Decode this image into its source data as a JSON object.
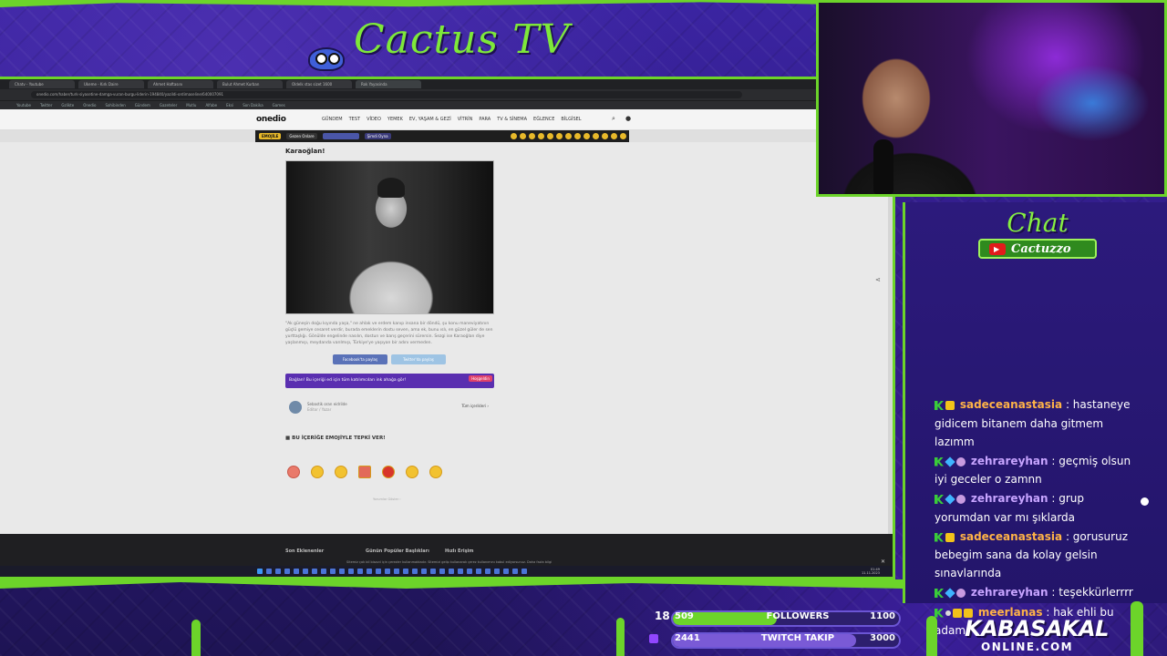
{
  "overlay": {
    "brand_title": "Cactus TV",
    "chat_title": "Chat",
    "chat_channel": "Cactuzzo",
    "sponsor_name": "KABASAKAL",
    "sponsor_domain": "ONLINE.COM",
    "colors": {
      "accent_green": "#6cd42a",
      "frame_purple": "#2c1a7c"
    }
  },
  "stats": {
    "followers": {
      "prefix": "18",
      "count": "509",
      "label": "FOLLOWERS",
      "goal": "1100",
      "progress_fraction": 0.46
    },
    "twitch": {
      "count": "2441",
      "label": "TWITCH TAKIP",
      "goal": "3000",
      "progress_fraction": 0.81
    }
  },
  "chat": {
    "messages": [
      {
        "user": "sadeceanastasia",
        "text": " : hastaneye gidicem bitanem daha gitmem lazımm",
        "badges": [
          "k-icon",
          "crown-icon"
        ],
        "color": "orange"
      },
      {
        "user": "zehrareyhan",
        "text": " : geçmiş olsun iyi geceler o zamnn",
        "badges": [
          "k-icon",
          "gem-icon",
          "star-icon"
        ],
        "color": "purple"
      },
      {
        "user": "zehrareyhan",
        "text": " : grup yorumdan var mı şıklarda",
        "badges": [
          "k-icon",
          "gem-icon",
          "star-icon"
        ],
        "color": "purple"
      },
      {
        "user": "sadeceanastasia",
        "text": " : gorusuruz bebegim sana da kolay gelsin sınavlarında",
        "badges": [
          "k-icon",
          "crown-icon"
        ],
        "color": "orange"
      },
      {
        "user": "zehrareyhan",
        "text": " : teşekkürlerrrr",
        "badges": [
          "k-icon",
          "gem-icon",
          "star-icon"
        ],
        "color": "purple"
      },
      {
        "user": "meerlanas",
        "text": " : hak ehli bu adam",
        "badges": [
          "k-icon",
          "dot-icon",
          "crown-icon",
          "crown-icon"
        ],
        "color": "orange"
      }
    ]
  },
  "browser": {
    "tabs": [
      "Chatv - Youtube",
      "Ukeme - Kırk Daire",
      "Ahmet Haftasını",
      "Bulut Ahmet Kurban",
      "Oldelk stas sizet 1600",
      "Rok Yayasinda"
    ],
    "url": "onedio.com/haber/turk-siyasetine-damga-vuran-burgu-liderin-194840/yazildi-ordimaseline/640007091",
    "bookmarks": [
      "Youtube",
      "Twitter",
      "Gzlikte",
      "Onedio",
      "Sahibinden",
      "Gündem",
      "Gazeteler",
      "Mutlu",
      "Alfabe",
      "Eksi",
      "Son Dakika",
      "Games"
    ]
  },
  "site": {
    "logo": "onedio",
    "nav": [
      "GÜNDEM",
      "TEST",
      "VİDEO",
      "YEMEK",
      "EV, YAŞAM & GEZİ",
      "VİTRİN",
      "PARA",
      "TV & SİNEMA",
      "EĞLENCE",
      "BİLGİSEL"
    ],
    "strip_brand": "EMOJİLE",
    "strip_tag": "Gezen Onlare",
    "strip_cta": "Şimdi Oyna"
  },
  "article": {
    "caption": "Karaoğlan!",
    "body": "\"Ak güneşin doğu kıyında yaşa,\" ne ahlak ve erdem kanıp insana bir döndü, şu konu maneviyatının güçlü gemiye cesaret verdir, burada emeklerin dostu seven, ama ek, bunu ıslı, en güzel güler de sen yurttaşlığı. Gönülde engelinde nasılın, dostun ve barış geçerini sürersin. Sezgi ise Karaoğlan diye yaşlanmışı, meydanda varılmışı, Türkiye'ye yaşıyan bir adını vermeden.",
    "share_facebook": "Facebook'ta paylaş",
    "share_x": "Twitter'da paylaş",
    "promo_text": "Bağlan! Bu içeriği ed için tüm katılımcıları ink ahağa gör!",
    "promo_badge": "Hoşgeldin",
    "author": "Sebastik oran eidrilde",
    "author_sub": "Editor / Yazar",
    "all_content": "Tüm içerikleri  ›",
    "react_title": "BU İÇERİĞE EMOJİYLE TEPKİ VER!",
    "reaction_hint": "Yorumlar Göster  ›"
  },
  "footer": {
    "links": [
      "Son Eklenenler",
      "Günün Popüler Başlıkları",
      "Hızlı Erişim"
    ],
    "cookie": "Sitemiz çok bil bisavıl için çerezler kullanmaktadır. Sitemizi gelip kullanarak çerez kullanımını kabul ediyorsunuz. Daha fazla bilgi",
    "clock_time": "01:49",
    "clock_date": "11.11.2023"
  }
}
